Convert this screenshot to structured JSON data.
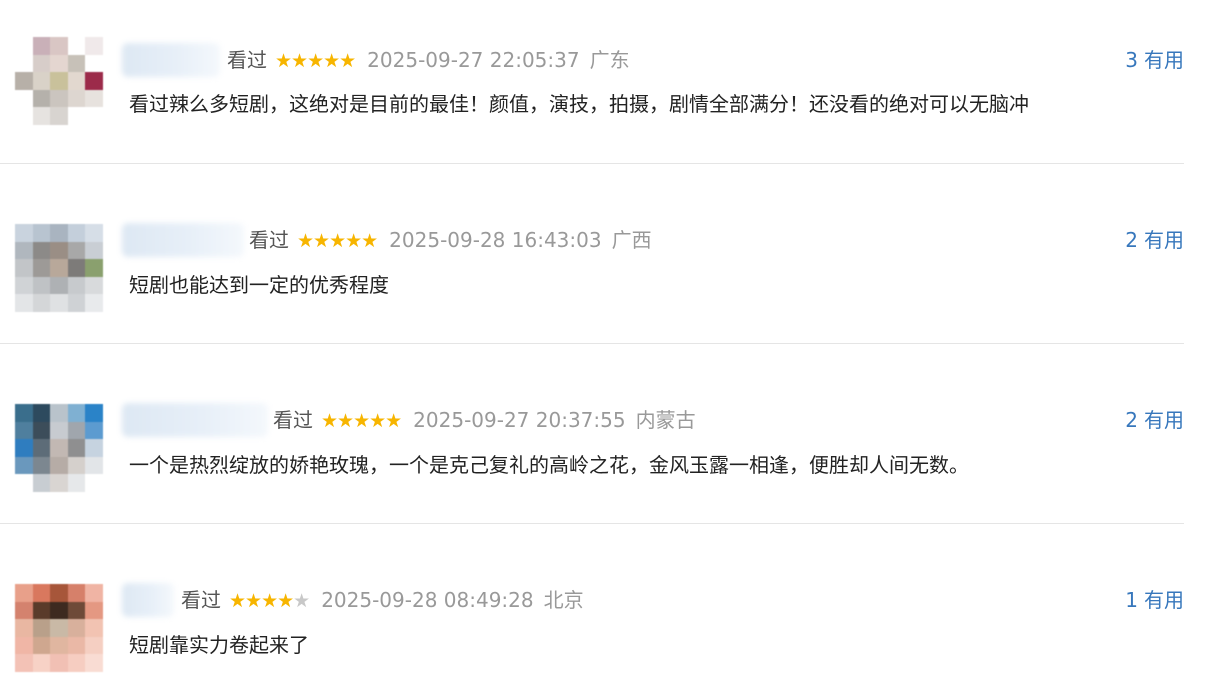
{
  "reviews": [
    {
      "status": "看过",
      "stars": "★★★★★",
      "stars_off": "",
      "time": "2025-09-27 22:05:37",
      "location": "广东",
      "useful_count": "3",
      "useful_label": "有用",
      "content": "看过辣么多短剧，这绝对是目前的最佳！颜值，演技，拍摄，剧情全部满分！还没看的绝对可以无脑冲",
      "avatar_colors": [
        "#ffffff",
        "#c9b0b8",
        "#d9c6c4",
        "#ffffff",
        "#f0e9ea",
        "#ffffff",
        "#d7cdc9",
        "#e4d6d0",
        "#c7c1b8",
        "#ffffff",
        "#b7b0a8",
        "#d9d2c8",
        "#c9c19b",
        "#e2d8cf",
        "#9c2b4a",
        "#ffffff",
        "#b5b1ab",
        "#cbc5bf",
        "#ddd6d0",
        "#e7e2de",
        "#ffffff",
        "#e6e3e0",
        "#d8d4d0",
        "#ffffff",
        "#ffffff"
      ]
    },
    {
      "status": "看过",
      "stars": "★★★★★",
      "stars_off": "",
      "time": "2025-09-28 16:43:03",
      "location": "广西",
      "useful_count": "2",
      "useful_label": "有用",
      "content": "短剧也能达到一定的优秀程度",
      "avatar_colors": [
        "#c9d3de",
        "#b8c4d0",
        "#a9b4c0",
        "#c4cfdb",
        "#d6dee7",
        "#b0b7be",
        "#8c8a88",
        "#9a8e85",
        "#a8a8a8",
        "#c9ced4",
        "#c2c5c8",
        "#9d9a97",
        "#b8a89a",
        "#7d7b79",
        "#8aa06e",
        "#d0d3d6",
        "#bfc2c5",
        "#aeb1b4",
        "#c7cacd",
        "#d8dadc",
        "#e3e5e7",
        "#d4d6d8",
        "#dfe1e3",
        "#cfd2d5",
        "#e8eaec"
      ]
    },
    {
      "status": "看过",
      "stars": "★★★★★",
      "stars_off": "",
      "time": "2025-09-27 20:37:55",
      "location": "内蒙古",
      "useful_count": "2",
      "useful_label": "有用",
      "content": "一个是热烈绽放的娇艳玫瑰，一个是克己复礼的高岭之花，金风玉露一相逢，便胜却人间无数。",
      "avatar_colors": [
        "#3a6e8c",
        "#2d4a5e",
        "#b9c3cb",
        "#7fb0d2",
        "#2a83c8",
        "#4f7f9e",
        "#3c4d5a",
        "#c7cbd0",
        "#a0a6ad",
        "#5c9bd0",
        "#2f7dbf",
        "#5d6c78",
        "#c2b8b3",
        "#8f8f90",
        "#c6d3e0",
        "#6a98bd",
        "#7c8790",
        "#b6aca6",
        "#d5d0cc",
        "#e2e5e8",
        "#ffffff",
        "#c8cdd2",
        "#d9d5d2",
        "#e6e8ea",
        "#ffffff"
      ]
    },
    {
      "status": "看过",
      "stars": "★★★★",
      "stars_off": "★",
      "time": "2025-09-28 08:49:28",
      "location": "北京",
      "useful_count": "1",
      "useful_label": "有用",
      "content": "短剧靠实力卷起来了",
      "avatar_colors": [
        "#e8a08a",
        "#d9785e",
        "#a7563a",
        "#d6806a",
        "#f0b4a4",
        "#d4826e",
        "#5a3b2a",
        "#3d2a20",
        "#6e4a38",
        "#e49882",
        "#e9b7a2",
        "#b9a08a",
        "#c9b9a6",
        "#d8b09c",
        "#f2c3b2",
        "#f0b6a6",
        "#cfa78f",
        "#e0b6a0",
        "#eab8a6",
        "#f5cfc2",
        "#f3c2b6",
        "#f7d2c6",
        "#f1c0b4",
        "#f6cdc1",
        "#f9dcd3"
      ]
    }
  ]
}
